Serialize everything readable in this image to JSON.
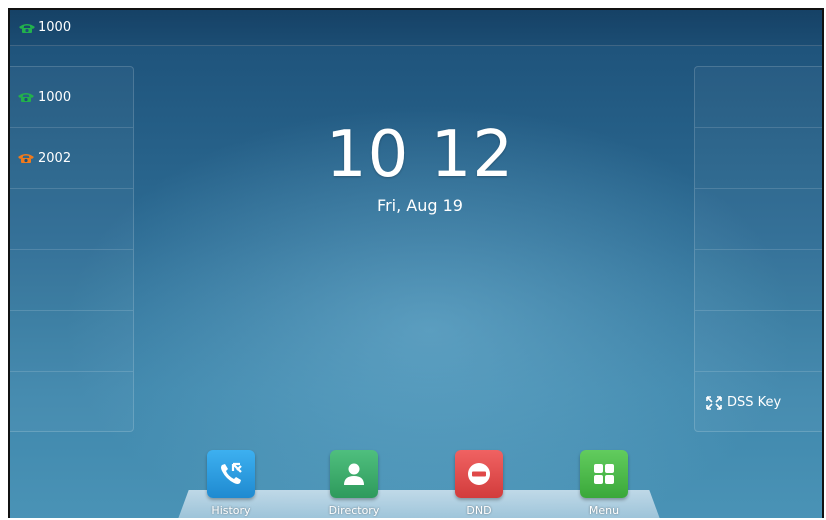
{
  "status_bar": {
    "account": {
      "label": "1000",
      "icon": "phone-handset-icon",
      "color": "#22b14c"
    }
  },
  "line_keys_left": [
    {
      "label": "1000",
      "icon": "phone-handset-icon",
      "color": "#22b14c"
    },
    {
      "label": "2002",
      "icon": "phone-handset-icon",
      "color": "#f07a1c"
    },
    {
      "label": ""
    },
    {
      "label": ""
    },
    {
      "label": ""
    },
    {
      "label": ""
    }
  ],
  "line_keys_right": [
    {
      "label": ""
    },
    {
      "label": ""
    },
    {
      "label": ""
    },
    {
      "label": ""
    },
    {
      "label": ""
    },
    {
      "label": "DSS Key",
      "icon": "expand-arrows-icon"
    }
  ],
  "clock": {
    "time": "10 12",
    "date": "Fri, Aug 19"
  },
  "softkeys": [
    {
      "label": "History",
      "icon": "call-history-icon",
      "color": "#2a9ee0"
    },
    {
      "label": "Directory",
      "icon": "contact-person-icon",
      "color": "#3aa86a"
    },
    {
      "label": "DND",
      "icon": "do-not-disturb-icon",
      "color": "#e04848"
    },
    {
      "label": "Menu",
      "icon": "menu-grid-icon",
      "color": "#4cb84c"
    }
  ]
}
